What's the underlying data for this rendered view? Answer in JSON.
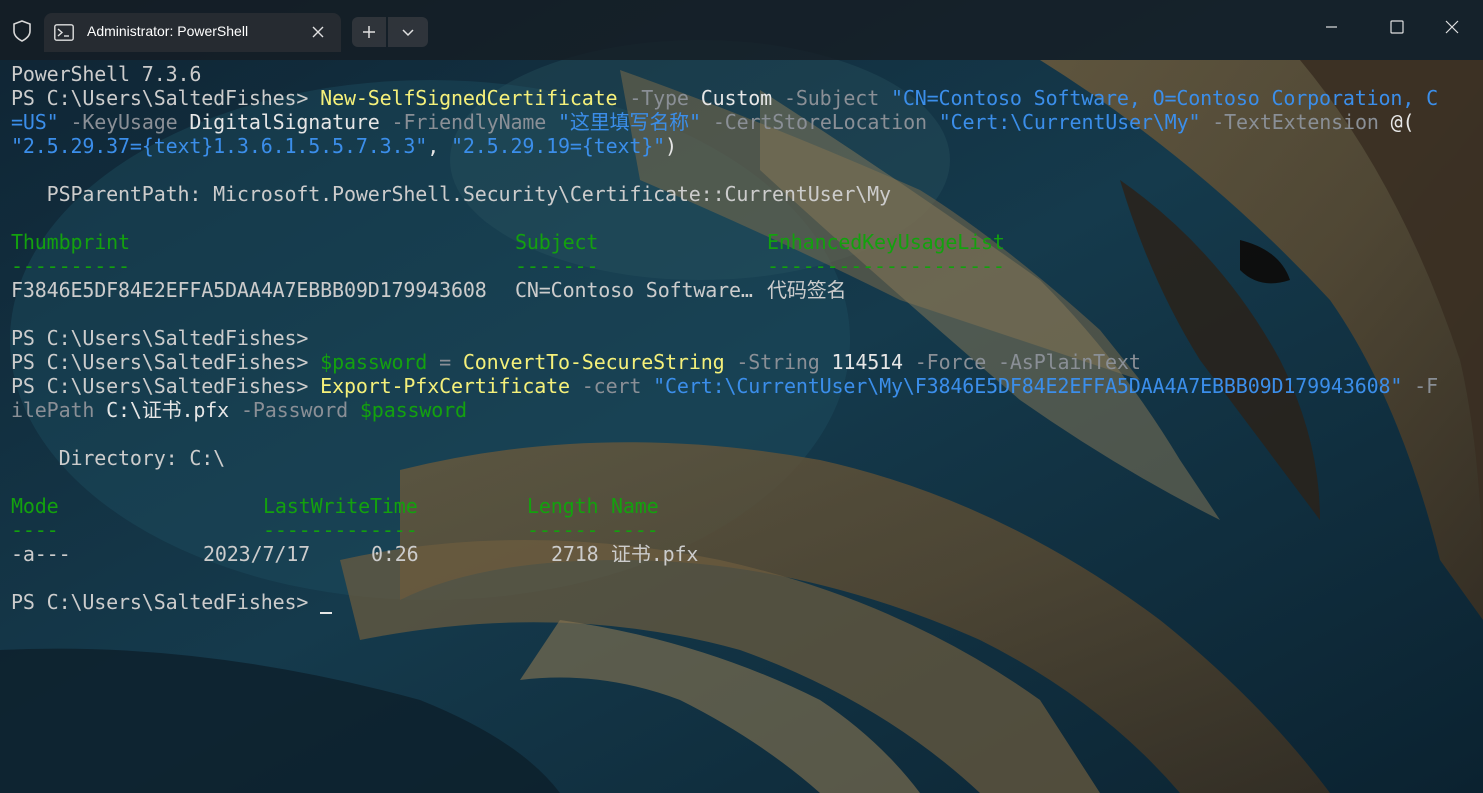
{
  "window": {
    "tab_title": "Administrator: PowerShell",
    "icons": [
      "shield-icon",
      "powershell-icon",
      "close-icon",
      "plus-icon",
      "chevron-down-icon",
      "minimize-icon",
      "maximize-icon",
      "window-close-icon"
    ]
  },
  "terminal": {
    "version": "PowerShell 7.3.6",
    "prompt": "PS C:\\Users\\SaltedFishes> ",
    "prompt_bare": "PS C:\\Users\\SaltedFishes>",
    "cmd1": {
      "name": "New-SelfSignedCertificate",
      "p_type": " -Type",
      "v_type": " Custom",
      "p_subject": " -Subject",
      "v_subject": " \"CN=Contoso Software, O=Contoso Corporation, C",
      "v_subject_cont": "=US\"",
      "p_keyusage": " -KeyUsage",
      "v_keyusage": " DigitalSignature",
      "p_friendly": " -FriendlyName",
      "v_friendly": " \"这里填写名称\"",
      "p_store": " -CertStoreLocation",
      "v_store": " \"Cert:\\CurrentUser\\My\"",
      "p_text": " -TextExtension",
      "v_text_open": " @(",
      "v_ext1": "\"2.5.29.37={text}1.3.6.1.5.5.7.3.3\"",
      "sep": ", ",
      "v_ext2": "\"2.5.29.19={text}\"",
      "close": ")"
    },
    "ps_parent_path": "   PSParentPath: Microsoft.PowerShell.Security\\Certificate::CurrentUser\\My",
    "cert_table": {
      "headers": [
        "Thumbprint",
        "Subject",
        "EnhancedKeyUsageList"
      ],
      "underlines": [
        "----------",
        "-------",
        "--------------------"
      ],
      "row": {
        "thumbprint": "F3846E5DF84E2EFFA5DAA4A7EBBB09D179943608",
        "subject": "CN=Contoso Software…",
        "eku": "代码签名"
      }
    },
    "cmd2": {
      "var": "$password",
      "eq": " = ",
      "name": "ConvertTo-SecureString",
      "p_string": " -String",
      "v_string": " 114514",
      "p_flags": " -Force -AsPlainText"
    },
    "cmd3": {
      "name": "Export-PfxCertificate",
      "p_cert": " -cert",
      "v_cert": " \"Cert:\\CurrentUser\\My\\F3846E5DF84E2EFFA5DAA4A7EBBB09D179943608\"",
      "p_filepath_start": " -F",
      "p_filepath_cont": "ilePath",
      "v_filepath": " C:\\证书.pfx",
      "p_password": " -Password",
      "v_password": " $password"
    },
    "directory": "    Directory: C:\\",
    "file_table": {
      "headers": [
        "Mode",
        "LastWriteTime",
        "Length",
        "Name"
      ],
      "underlines": [
        "----",
        "-------------",
        "------",
        "----"
      ],
      "row": {
        "mode": "-a---",
        "date": "2023/7/17",
        "time": "0:26",
        "length": "2718",
        "name": "证书.pfx"
      }
    }
  }
}
